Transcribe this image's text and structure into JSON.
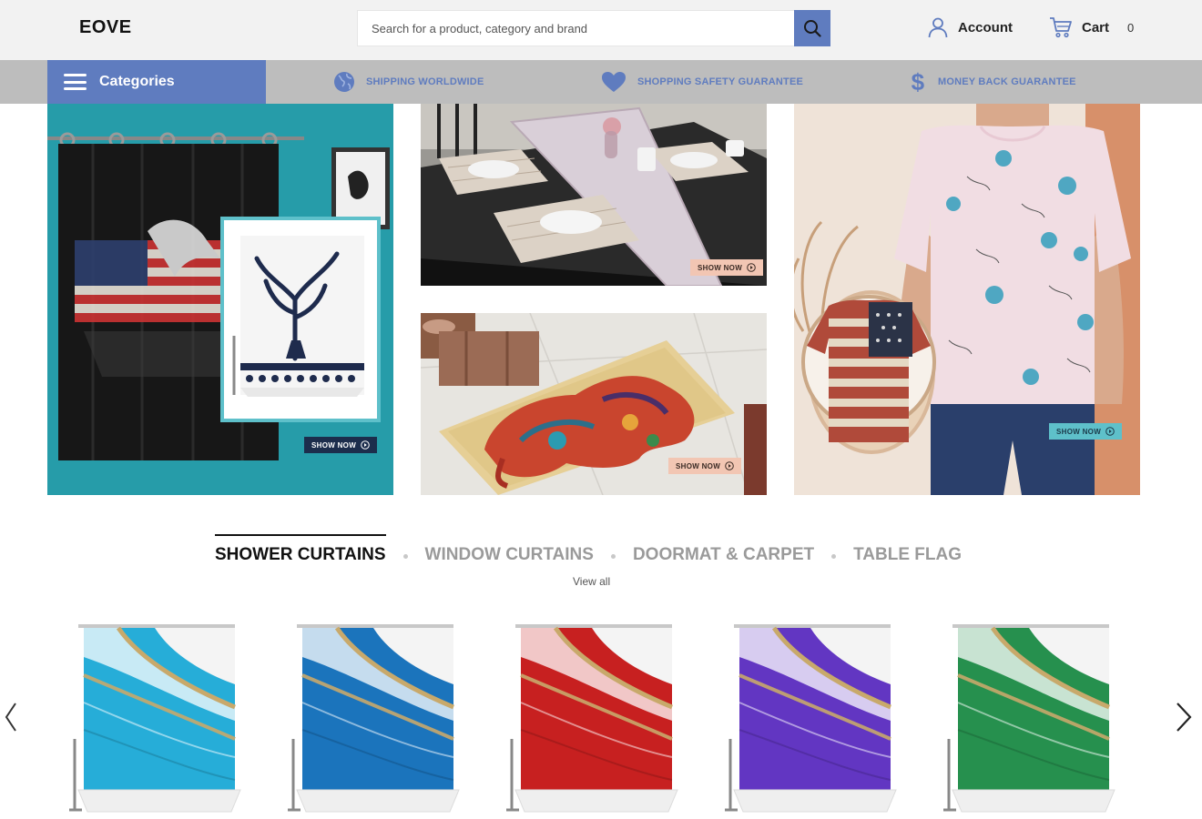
{
  "header": {
    "logo": "EOVE",
    "search_placeholder": "Search for a product, category and brand",
    "account_label": "Account",
    "cart_label": "Cart",
    "cart_count": "0"
  },
  "navbar": {
    "categories_label": "Categories",
    "features": [
      "SHIPPING WORLDWIDE",
      "SHOPPING SAFETY GUARANTEE",
      "MONEY BACK GUARANTEE"
    ]
  },
  "banners": {
    "show_now_label": "SHOW NOW"
  },
  "tabs": [
    "SHOWER CURTAINS",
    "WINDOW CURTAINS",
    "DOORMAT & CARPET",
    "TABLE FLAG"
  ],
  "active_tab": "SHOWER CURTAINS",
  "view_all": "View all",
  "colors": {
    "accent": "#5f7cbf",
    "header_bg": "#f2f2f2",
    "navbar_bg": "#bdbdbd",
    "product_variants": [
      "#1aa9d6",
      "#0f6db8",
      "#c41414",
      "#5a2bbf",
      "#1a8a44"
    ]
  }
}
